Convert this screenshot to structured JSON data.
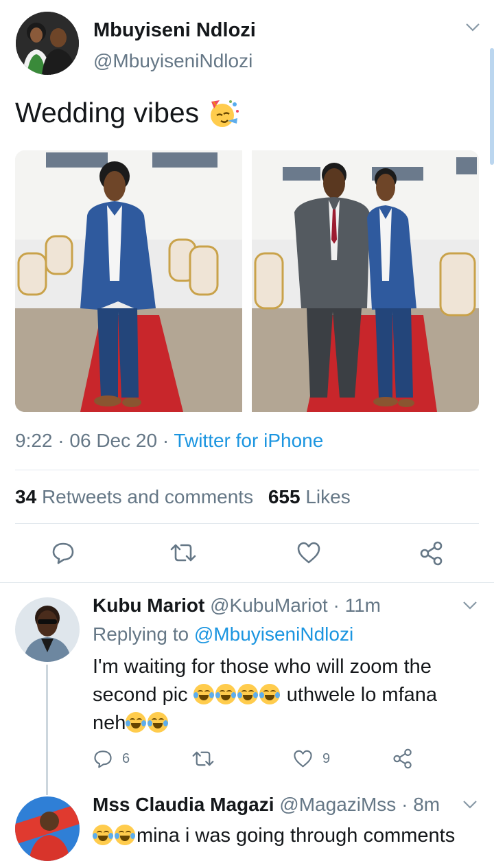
{
  "tweet": {
    "author_name": "Mbuyiseni Ndlozi",
    "author_handle": "@MbuyiseniNdlozi",
    "text": "Wedding vibes",
    "emoji_icon": "partying-face",
    "time": "9:22",
    "date": "06 Dec 20",
    "sep": "·",
    "source": "Twitter for iPhone",
    "retweets_count": "34",
    "retweets_label": "Retweets and comments",
    "likes_count": "655",
    "likes_label": "Likes"
  },
  "replies": [
    {
      "name": "Kubu Mariot",
      "handle": "@KubuMariot",
      "sep": "·",
      "time": "11m",
      "replying_prefix": "Replying to",
      "replying_handle": "@MbuyiseniNdlozi",
      "line1": "I'm waiting for those who will zoom the",
      "line2_a": "second pic",
      "line2_b": "uthwele lo mfana",
      "line3_a": "neh",
      "emoji_icon": "face-with-tears-of-joy",
      "reply_count": "6",
      "retweet_count": "",
      "like_count": "9"
    },
    {
      "name": "Mss Claudia Magazi",
      "handle": "@MagaziMss",
      "sep": "·",
      "time": "8m",
      "text": "mina i was going through comments",
      "emoji_icon": "face-with-tears-of-joy"
    }
  ],
  "colors": {
    "accent": "#1b95e0",
    "muted": "#657786",
    "divider": "#e1e8ed",
    "carpet": "#c8262b",
    "suit": "#2f5a9e"
  }
}
